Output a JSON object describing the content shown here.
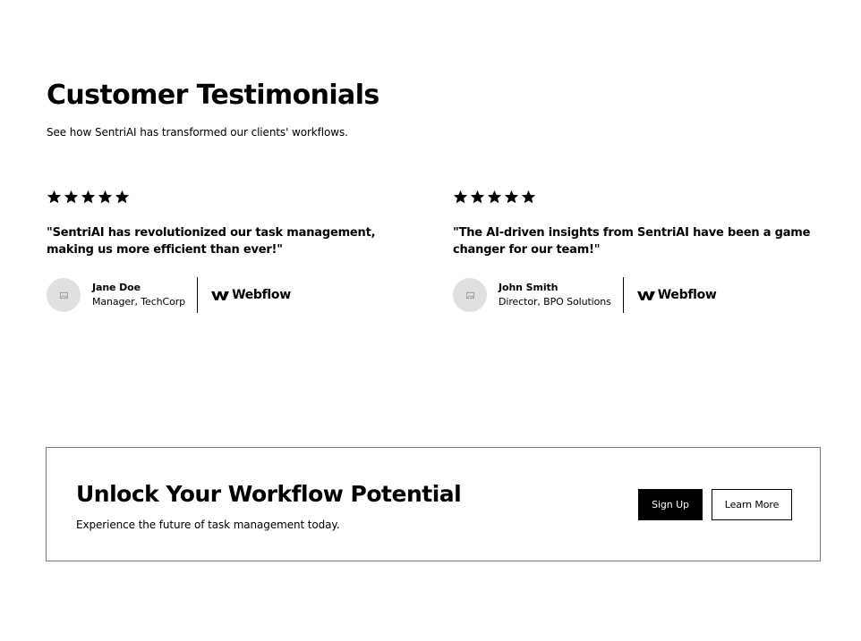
{
  "testimonials": {
    "title": "Customer Testimonials",
    "subtitle": "See how SentriAI has transformed our clients' workflows.",
    "items": [
      {
        "rating": 5,
        "quote": "\"SentriAI has revolutionized our task management, making us more efficient than ever!\"",
        "name": "Jane Doe",
        "role": "Manager, TechCorp",
        "logo": "Webflow"
      },
      {
        "rating": 5,
        "quote": "\"The AI-driven insights from SentriAI have been a game changer for our team!\"",
        "name": "John Smith",
        "role": "Director, BPO Solutions",
        "logo": "Webflow"
      }
    ]
  },
  "cta": {
    "title": "Unlock Your Workflow Potential",
    "subtitle": "Experience the future of task management today.",
    "primary_label": "Sign Up",
    "secondary_label": "Learn More"
  },
  "icons": {
    "star": "star-icon",
    "avatar": "image-placeholder-icon",
    "logo": "webflow-logo-icon"
  }
}
